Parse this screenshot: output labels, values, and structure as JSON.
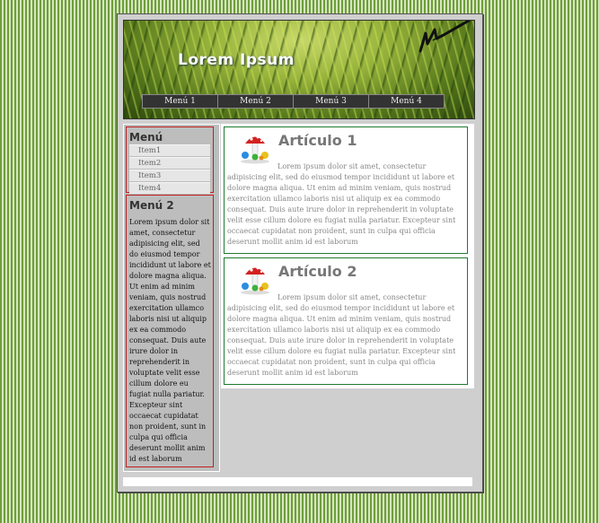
{
  "header": {
    "site_title": "Lorem Ipsum",
    "logo": "signature-logo"
  },
  "nav": {
    "items": [
      {
        "label": "Menú 1"
      },
      {
        "label": "Menú 2"
      },
      {
        "label": "Menú 3"
      },
      {
        "label": "Menú 4"
      }
    ]
  },
  "sidebar": {
    "menu1": {
      "title": "Menú",
      "items": [
        {
          "label": "Item1"
        },
        {
          "label": "Item2"
        },
        {
          "label": "Item3"
        },
        {
          "label": "Item4"
        }
      ]
    },
    "menu2": {
      "title": "Menú 2",
      "text": "Lorem ipsum dolor sit amet, consectetur adipisicing elit, sed do eiusmod tempor incididunt ut labore et dolore magna aliqua. Ut enim ad minim veniam, quis nostrud exercitation ullamco laboris nisi ut aliquip ex ea commodo consequat. Duis aute irure dolor in reprehenderit in voluptate velit esse cillum dolore eu fugiat nulla pariatur. Excepteur sint occaecat cupidatat non proident, sunt in culpa qui officia deserunt mollit anim id est laborum"
    }
  },
  "articles": [
    {
      "title": "Artículo 1",
      "icon": "mushroom-icon",
      "text": "Lorem ipsum dolor sit amet, consectetur adipisicing elit, sed do eiusmod tempor incididunt ut labore et dolore magna aliqua. Ut enim ad minim veniam, quis nostrud exercitation ullamco laboris nisi ut aliquip ex ea commodo consequat. Duis aute irure dolor in reprehenderit in voluptate velit esse cillum dolore eu fugiat nulla pariatur. Excepteur sint occaecat cupidatat non proident, sunt in culpa qui officia deserunt mollit anim id est laborum"
    },
    {
      "title": "Artículo 2",
      "icon": "mushroom-icon",
      "text": "Lorem ipsum dolor sit amet, consectetur adipisicing elit, sed do eiusmod tempor incididunt ut labore et dolore magna aliqua. Ut enim ad minim veniam, quis nostrud exercitation ullamco laboris nisi ut aliquip ex ea commodo consequat. Duis aute irure dolor in reprehenderit in voluptate velit esse cillum dolore eu fugiat nulla pariatur. Excepteur sint occaecat cupidatat non proident, sunt in culpa qui officia deserunt mollit anim id est laborum"
    }
  ],
  "colors": {
    "page_stripes": "#6e9e3a",
    "nav_bg": "#333333",
    "sidebar_border": "#c02020",
    "article_border": "#1e7a2e",
    "article_title": "#777777"
  }
}
